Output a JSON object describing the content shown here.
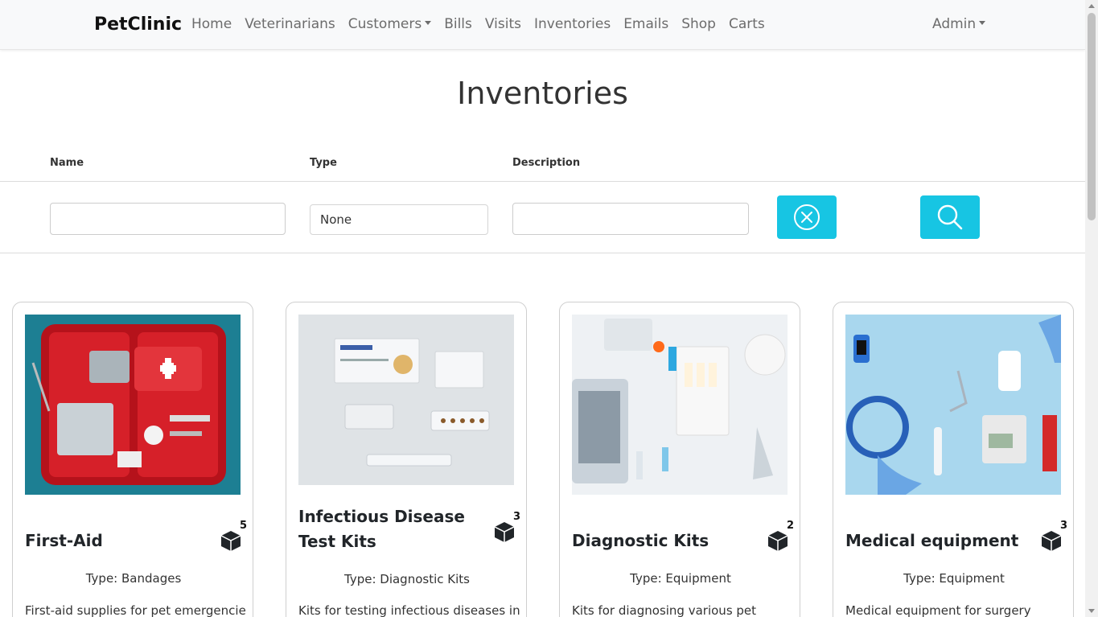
{
  "navbar": {
    "brand": "PetClinic",
    "links": [
      {
        "label": "Home"
      },
      {
        "label": "Veterinarians"
      },
      {
        "label": "Customers",
        "dropdown": true
      },
      {
        "label": "Bills"
      },
      {
        "label": "Visits"
      },
      {
        "label": "Inventories"
      },
      {
        "label": "Emails"
      },
      {
        "label": "Shop"
      },
      {
        "label": "Carts"
      }
    ],
    "admin_label": "Admin"
  },
  "page": {
    "title": "Inventories"
  },
  "filters": {
    "name_label": "Name",
    "type_label": "Type",
    "description_label": "Description",
    "name_value": "",
    "type_value": "None",
    "description_value": "",
    "clear_icon": "circle-x-icon",
    "search_icon": "search-icon"
  },
  "cards": [
    {
      "title": "First-Aid",
      "quantity": "5",
      "type": "Type: Bandages",
      "description": "First-aid supplies for pet emergencies"
    },
    {
      "title": "Infectious Disease Test Kits",
      "quantity": "3",
      "type": "Type: Diagnostic Kits",
      "description": "Kits for testing infectious diseases in"
    },
    {
      "title": "Diagnostic Kits",
      "quantity": "2",
      "type": "Type: Equipment",
      "description": "Kits for diagnosing various pet"
    },
    {
      "title": "Medical equipment",
      "quantity": "3",
      "type": "Type: Equipment",
      "description": "Medical equipment for surgery"
    }
  ],
  "colors": {
    "accent": "#17c5e3",
    "navbar_bg": "#f8f9fa"
  }
}
